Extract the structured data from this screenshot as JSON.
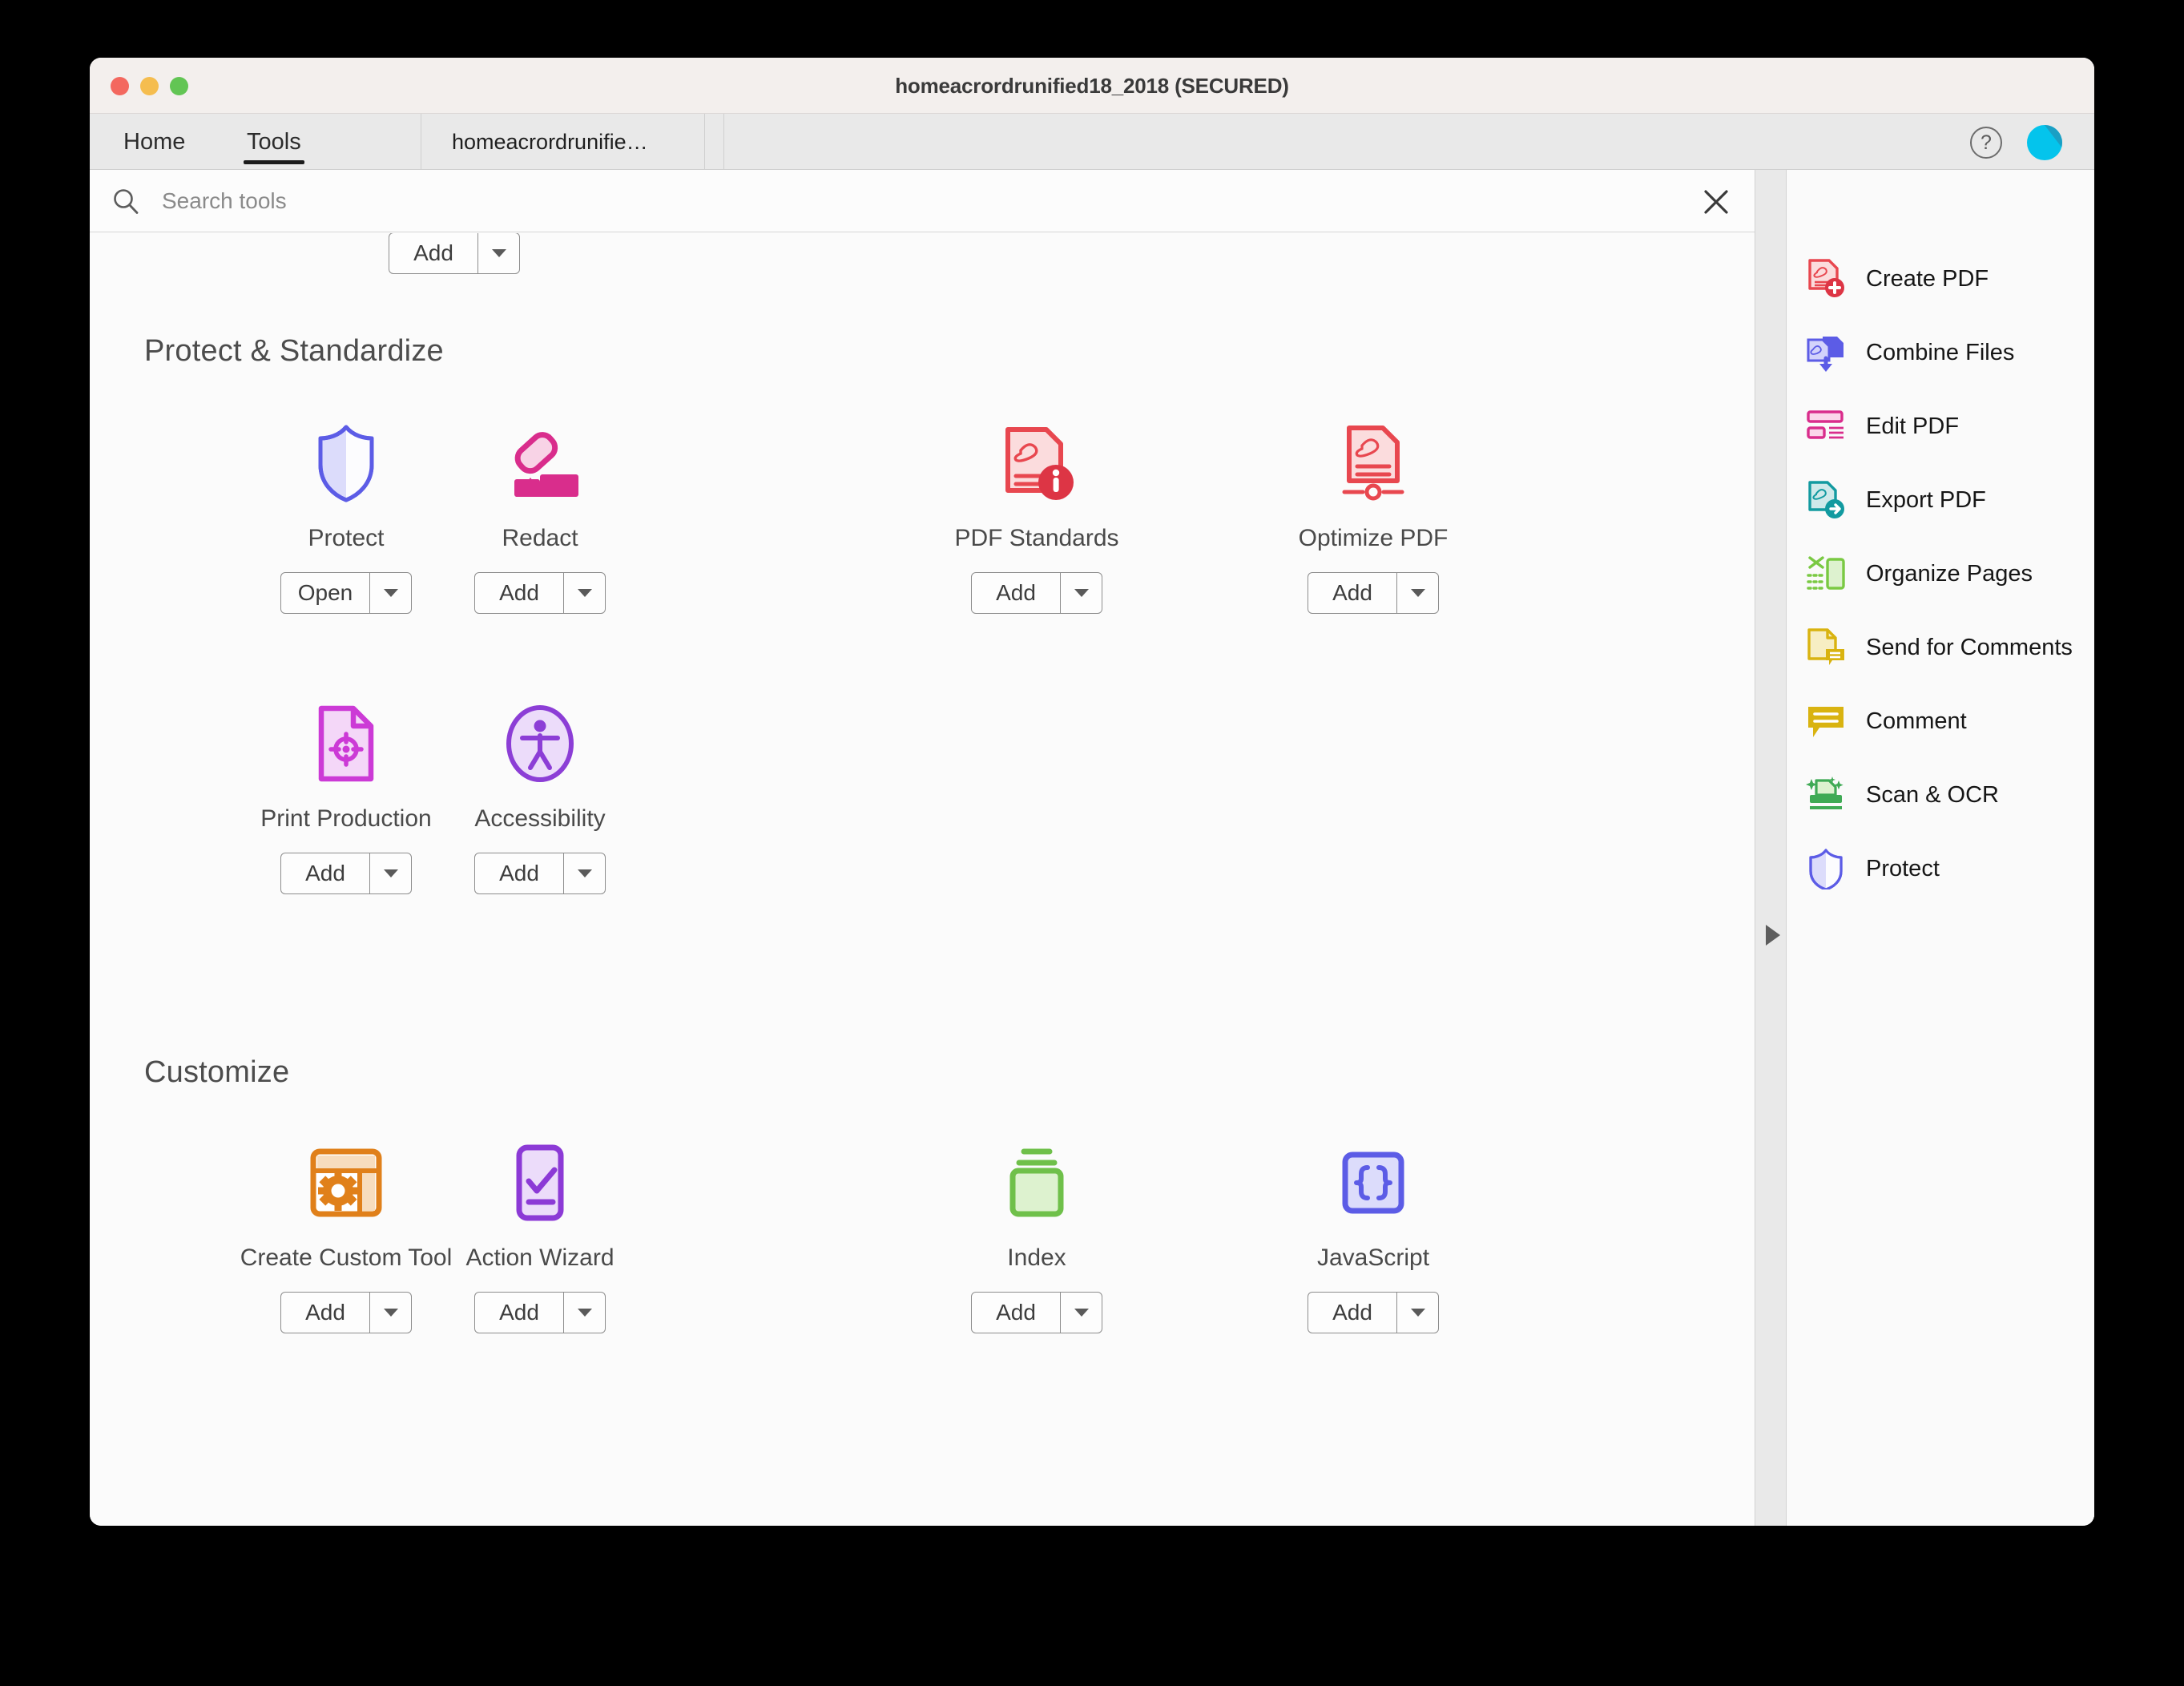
{
  "window": {
    "title": "homeacrordrunified18_2018 (SECURED)",
    "traffic_lights": [
      "close",
      "minimize",
      "maximize"
    ]
  },
  "tabs": [
    {
      "id": "home",
      "label": "Home",
      "active": false
    },
    {
      "id": "tools",
      "label": "Tools",
      "active": true
    },
    {
      "id": "doc",
      "label": "homeacrordrunifie…",
      "active": false
    }
  ],
  "titlebar_actions": {
    "help_glyph": "?",
    "avatar_color": "#04c4ec"
  },
  "search": {
    "placeholder": "Search tools",
    "value": "",
    "clear_label": "×"
  },
  "top_partial_tool": {
    "button": "Add"
  },
  "sections": [
    {
      "id": "protect-standardize",
      "title": "Protect & Standardize",
      "tools": [
        {
          "id": "protect",
          "label": "Protect",
          "button": "Open",
          "icon": "shield-icon",
          "color": "#5c5ce6"
        },
        {
          "id": "redact",
          "label": "Redact",
          "button": "Add",
          "icon": "highlighter-icon",
          "color": "#d92d8c"
        },
        {
          "id": "pdf-standards",
          "label": "PDF Standards",
          "button": "Add",
          "icon": "pdf-info-icon",
          "color": "#e8474f"
        },
        {
          "id": "optimize-pdf",
          "label": "Optimize PDF",
          "button": "Add",
          "icon": "pdf-optimize-icon",
          "color": "#e8474f"
        },
        {
          "id": "print-production",
          "label": "Print Production",
          "button": "Add",
          "icon": "print-target-icon",
          "color": "#cc3ad6"
        },
        {
          "id": "accessibility",
          "label": "Accessibility",
          "button": "Add",
          "icon": "accessibility-icon",
          "color": "#8c3ed6"
        }
      ]
    },
    {
      "id": "customize",
      "title": "Customize",
      "tools": [
        {
          "id": "create-custom-tool",
          "label": "Create Custom Tool",
          "button": "Add",
          "icon": "custom-tool-icon",
          "color": "#e0801a"
        },
        {
          "id": "action-wizard",
          "label": "Action Wizard",
          "button": "Add",
          "icon": "action-wizard-icon",
          "color": "#8c3ad6"
        },
        {
          "id": "index",
          "label": "Index",
          "button": "Add",
          "icon": "index-icon",
          "color": "#6fc04a"
        },
        {
          "id": "javascript",
          "label": "JavaScript",
          "button": "Add",
          "icon": "javascript-icon",
          "color": "#5c5ce6"
        }
      ]
    }
  ],
  "right_panel": {
    "items": [
      {
        "id": "create-pdf",
        "label": "Create PDF",
        "icon": "create-pdf-icon",
        "color": "#e8474f"
      },
      {
        "id": "combine-files",
        "label": "Combine Files",
        "icon": "combine-files-icon",
        "color": "#5c5ce6"
      },
      {
        "id": "edit-pdf",
        "label": "Edit PDF",
        "icon": "edit-pdf-icon",
        "color": "#d92d8c"
      },
      {
        "id": "export-pdf",
        "label": "Export PDF",
        "icon": "export-pdf-icon",
        "color": "#129aa0"
      },
      {
        "id": "organize-pages",
        "label": "Organize Pages",
        "icon": "organize-pages-icon",
        "color": "#7ac943"
      },
      {
        "id": "send-for-comments",
        "label": "Send for Comments",
        "icon": "send-comments-icon",
        "color": "#d9b310"
      },
      {
        "id": "comment",
        "label": "Comment",
        "icon": "comment-icon",
        "color": "#d9b310"
      },
      {
        "id": "scan-ocr",
        "label": "Scan & OCR",
        "icon": "scan-ocr-icon",
        "color": "#3faa55"
      },
      {
        "id": "protect",
        "label": "Protect",
        "icon": "shield-icon",
        "color": "#5c5ce6"
      }
    ]
  },
  "scrollbar": {
    "orientation": "vertical",
    "position_pct": 65
  },
  "panel_expander": {
    "direction": "right"
  }
}
